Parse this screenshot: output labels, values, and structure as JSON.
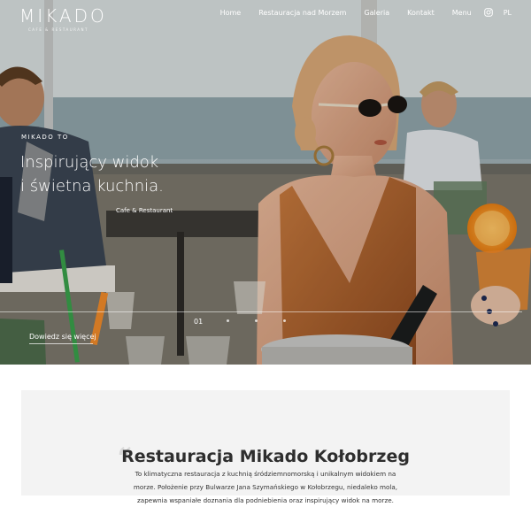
{
  "header": {
    "logo": "MIKADO",
    "logo_sub": "CAFE & RESTAURANT",
    "nav": [
      {
        "label": "Home"
      },
      {
        "label": "Restauracja nad Morzem"
      },
      {
        "label": "Galeria"
      },
      {
        "label": "Kontakt"
      },
      {
        "label": "Menu"
      }
    ],
    "instagram_icon": "instagram-icon",
    "lang": "PL"
  },
  "hero": {
    "eyebrow": "MIKADO TO",
    "headline_line1": "Inspirujący widok",
    "headline_line2": "i świetna kuchnia.",
    "tagline": "Cafe & Restaurant",
    "slide_number": "01",
    "slider_dots": 3,
    "cta": "Dowiedz się więcej"
  },
  "intro": {
    "title": "Restauracja Mikado Kołobrzeg",
    "body": "To klimatyczna restauracja z kuchnią śródziemnomorską i unikalnym widokiem na morze. Położenie przy Bulwarze Jana Szymańskiego w Kołobrzegu, niedaleko mola, zapewnia wspaniałe doznania dla podniebienia oraz inspirujący widok na morze."
  },
  "colors": {
    "text_dark": "#2e2e2e",
    "intro_bg": "#f3f3f3"
  }
}
